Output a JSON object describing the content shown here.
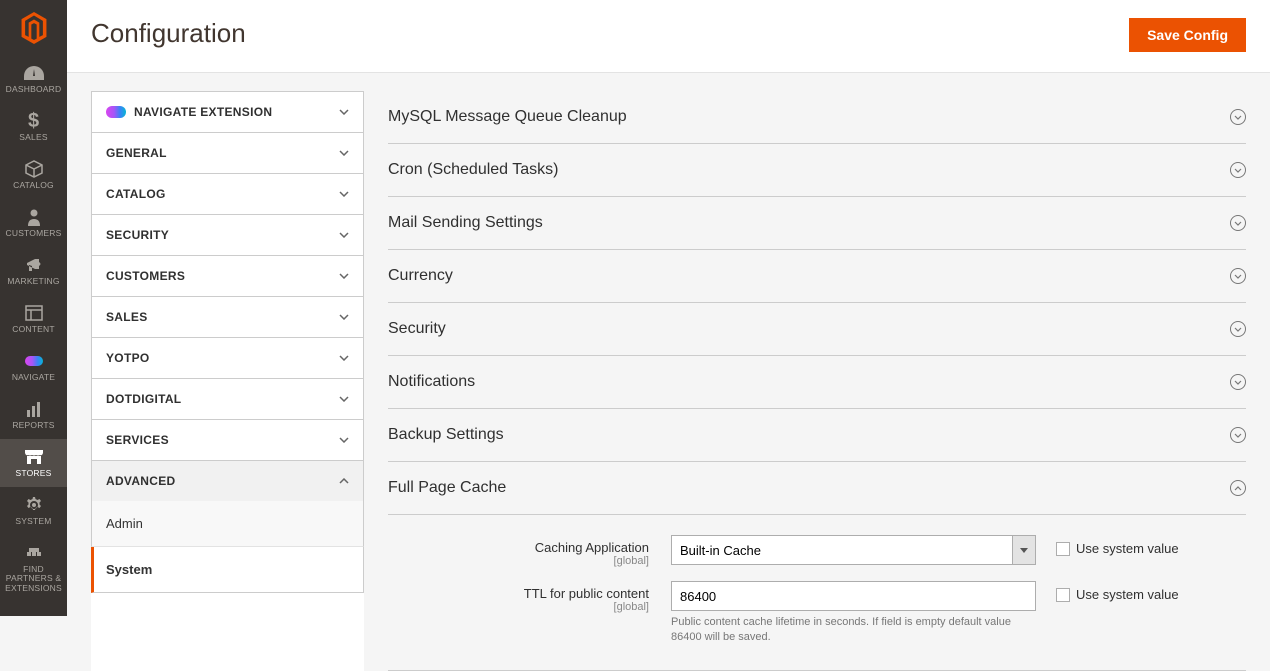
{
  "header": {
    "title": "Configuration",
    "saveLabel": "Save Config"
  },
  "sidebar": {
    "items": [
      {
        "label": "DASHBOARD"
      },
      {
        "label": "SALES"
      },
      {
        "label": "CATALOG"
      },
      {
        "label": "CUSTOMERS"
      },
      {
        "label": "MARKETING"
      },
      {
        "label": "CONTENT"
      },
      {
        "label": "NAVIGATE"
      },
      {
        "label": "REPORTS"
      },
      {
        "label": "STORES"
      },
      {
        "label": "SYSTEM"
      },
      {
        "label": "FIND PARTNERS & EXTENSIONS"
      }
    ]
  },
  "configNav": {
    "sections": [
      {
        "label": "NAVIGATE EXTENSION",
        "hasBadge": true
      },
      {
        "label": "GENERAL"
      },
      {
        "label": "CATALOG"
      },
      {
        "label": "SECURITY"
      },
      {
        "label": "CUSTOMERS"
      },
      {
        "label": "SALES"
      },
      {
        "label": "YOTPO"
      },
      {
        "label": "DOTDIGITAL"
      },
      {
        "label": "SERVICES"
      },
      {
        "label": "ADVANCED",
        "expanded": true
      }
    ],
    "advancedSubs": [
      {
        "label": "Admin"
      },
      {
        "label": "System",
        "active": true
      }
    ]
  },
  "configSections": [
    {
      "title": "MySQL Message Queue Cleanup"
    },
    {
      "title": "Cron (Scheduled Tasks)"
    },
    {
      "title": "Mail Sending Settings"
    },
    {
      "title": "Currency"
    },
    {
      "title": "Security"
    },
    {
      "title": "Notifications"
    },
    {
      "title": "Backup Settings"
    },
    {
      "title": "Full Page Cache",
      "expanded": true
    }
  ],
  "fullPageCache": {
    "cachingApp": {
      "label": "Caching Application",
      "scope": "[global]",
      "value": "Built-in Cache",
      "useSystem": "Use system value"
    },
    "ttl": {
      "label": "TTL for public content",
      "scope": "[global]",
      "value": "86400",
      "note": "Public content cache lifetime in seconds. If field is empty default value 86400 will be saved.",
      "useSystem": "Use system value"
    }
  }
}
